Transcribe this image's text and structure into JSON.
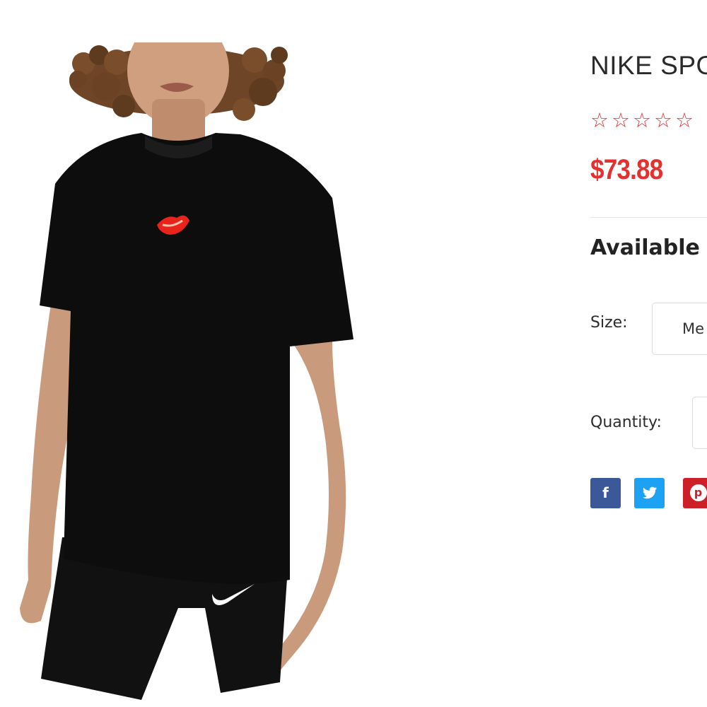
{
  "product": {
    "title": "NIKE SPO",
    "rating": {
      "stars_filled": 0,
      "stars_total": 5,
      "star_glyph": "☆"
    },
    "price": "$73.88",
    "available_heading": "Available (",
    "size": {
      "label": "Size:",
      "selected_value": "Me"
    },
    "quantity": {
      "label": "Quantity:"
    }
  },
  "share": {
    "facebook_glyph": "f",
    "twitter_glyph": "🐦",
    "pinterest_glyph": "p"
  },
  "colors": {
    "accent_red": "#e53030",
    "facebook": "#3b5998",
    "twitter": "#1da1f2",
    "pinterest": "#cb2027",
    "shirt": "#0d0d0d",
    "skin": "#c99a7c",
    "hair": "#6e4526",
    "lips_logo": "#e8231c"
  },
  "icons": {
    "star": "star-outline-icon",
    "facebook": "facebook-icon",
    "twitter": "twitter-icon",
    "pinterest": "pinterest-icon",
    "lips_logo": "lips-logo-icon",
    "swoosh": "nike-swoosh-icon"
  }
}
